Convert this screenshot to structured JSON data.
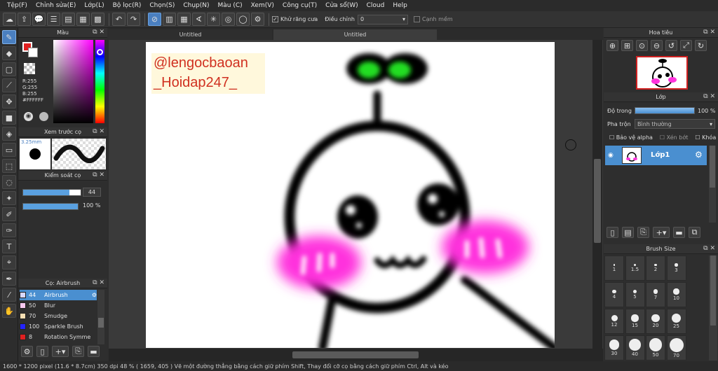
{
  "menu": [
    "Tệp(F)",
    "Chỉnh sửa(E)",
    "Lớp(L)",
    "Bộ lọc(R)",
    "Chọn(S)",
    "Chụp(N)",
    "Màu (C)",
    "Xem(V)",
    "Công cụ(T)",
    "Cửa sổ(W)",
    "Cloud",
    "Help"
  ],
  "toolbar": {
    "antialias_label": "Khử răng cưa",
    "adjust_label": "Điều chỉnh",
    "adjust_value": "0",
    "smooth_label": "Cạnh mềm"
  },
  "color_panel": {
    "title": "Màu",
    "r": "R:255",
    "g": "G:255",
    "b": "B:255",
    "hex": "#FFFFFF"
  },
  "preview_panel": {
    "title": "Xem trước cọ",
    "size": "3.25mm"
  },
  "brush_control": {
    "title": "Kiểm soát cọ",
    "size_value": "44",
    "opacity_value": "100 %",
    "size_fraction": 0.8,
    "opacity_fraction": 1.0
  },
  "brush_list": {
    "title": "Cọ: Airbrush",
    "items": [
      {
        "size": "44",
        "name": "Airbrush",
        "color": "#d8d8ff"
      },
      {
        "size": "50",
        "name": "Blur",
        "color": "#f7c8f0"
      },
      {
        "size": "70",
        "name": "Smudge",
        "color": "#f5deb3"
      },
      {
        "size": "100",
        "name": "Sparkle Brush",
        "color": "#2424ff"
      },
      {
        "size": "8",
        "name": "Rotation Symme",
        "color": "#e02020"
      }
    ]
  },
  "tabs": [
    "Untitled",
    "Untitled"
  ],
  "canvas": {
    "watermark_line1": "@lengocbaoan",
    "watermark_line2": "_Hoidap247_"
  },
  "navigator": {
    "title": "Hoa tiêu"
  },
  "layer_panel": {
    "title": "Lớp",
    "opacity_label": "Độ trong",
    "opacity_value": "100 %",
    "blend_label": "Pha trộn",
    "blend_value": "Bình thường",
    "protect_alpha": "Bảo vệ alpha",
    "clipping": "Xén bớt",
    "lock": "Khóa",
    "layer_name": "Lớp1"
  },
  "brush_size": {
    "title": "Brush Size",
    "sizes": [
      "1",
      "1.5",
      "2",
      "3",
      "4",
      "5",
      "7",
      "10",
      "12",
      "15",
      "20",
      "25",
      "30",
      "40",
      "50",
      "70"
    ]
  },
  "status": {
    "text": "1600 * 1200 pixel   (11.6 * 8.7cm)   350 dpi   48 %   ( 1659, 405 )   Vẽ một đường thẳng bằng cách giữ phím Shift, Thay đổi cỡ cọ bằng cách giữ phím Ctrl, Alt và kéo"
  },
  "colors": {
    "accent": "#4a8fd0",
    "cheek": "#ff33dd",
    "sprout": "#22dd22"
  }
}
